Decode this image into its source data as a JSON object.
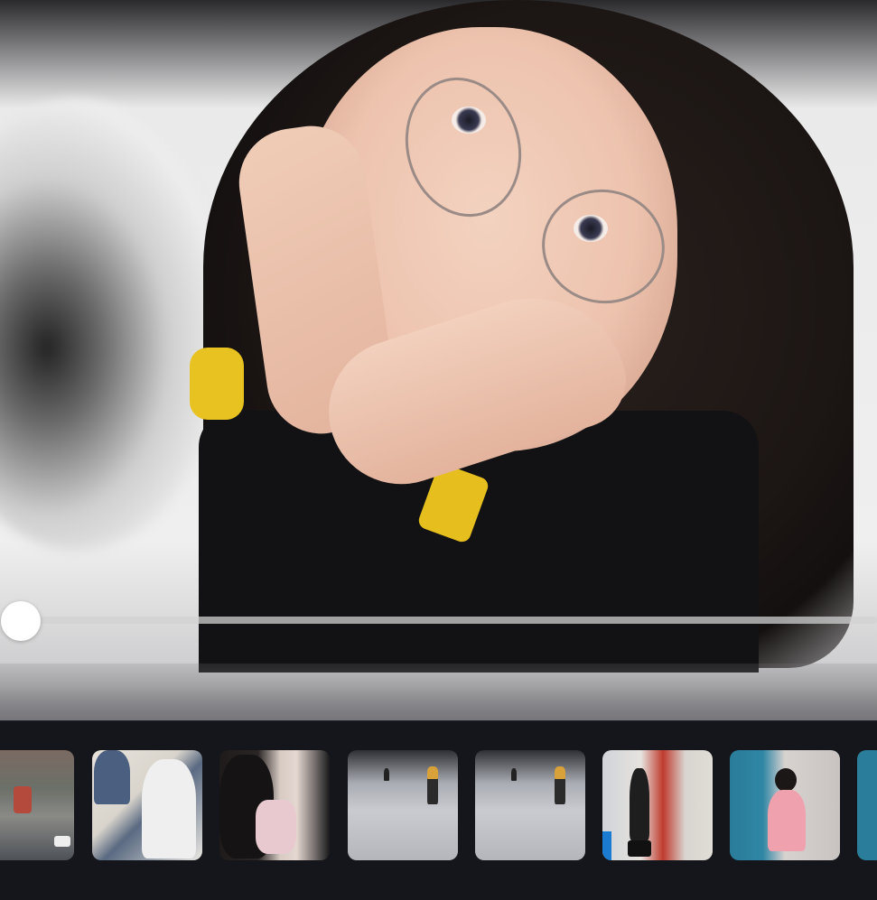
{
  "viewer": {
    "photo_description": "",
    "scrubber_progress": 0.0
  },
  "filmstrip": {
    "thumbnails": [
      {
        "id": "t1",
        "scene": "street"
      },
      {
        "id": "t2",
        "scene": "room"
      },
      {
        "id": "t3",
        "scene": "hair"
      },
      {
        "id": "t4",
        "scene": "hall"
      },
      {
        "id": "t5",
        "scene": "hall"
      },
      {
        "id": "t6",
        "scene": "stage"
      },
      {
        "id": "t7",
        "scene": "portrait"
      },
      {
        "id": "t8",
        "scene": "partial"
      }
    ]
  },
  "colors": {
    "background": "#15161b",
    "scrubber_track": "#d2d2d2",
    "scrubber_thumb": "#ffffff"
  }
}
